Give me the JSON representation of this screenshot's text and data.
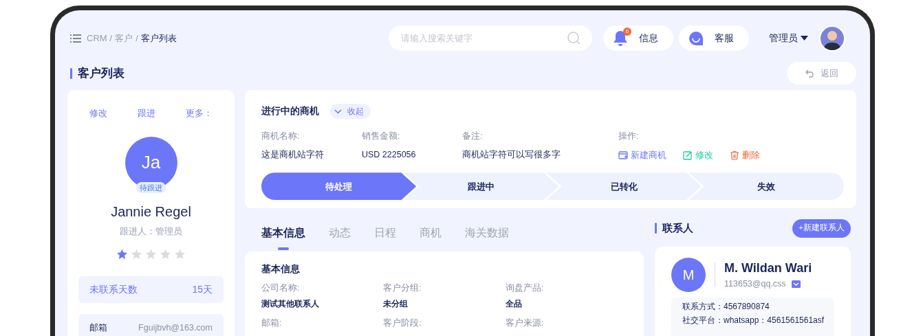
{
  "header": {
    "breadcrumb": [
      {
        "label": "CRM",
        "current": false
      },
      {
        "label": "客户",
        "current": false
      },
      {
        "label": "客户列表",
        "current": true
      }
    ],
    "separator": "/",
    "search": {
      "placeholder": "请输入搜索关键字"
    },
    "messages": {
      "label": "信息",
      "badge": "6"
    },
    "support": {
      "label": "客服"
    },
    "user": {
      "name": "管理员"
    }
  },
  "page_title": "客户列表",
  "back_button": "返回",
  "customer": {
    "actions": [
      "修改",
      "跟进",
      "更多："
    ],
    "initials": "Ja",
    "status_badge": "待跟进",
    "name": "Jannie Regel",
    "follower": "跟进人：管理员",
    "stars": 1,
    "days_uncontacted": {
      "label": "未联系天数",
      "value": "15天"
    },
    "email": {
      "label": "邮箱",
      "value": "Fguijbvh@163.com"
    }
  },
  "opportunities": {
    "title": "进行中的商机",
    "collapse_button": "收起",
    "fields": [
      {
        "label": "商机名称:",
        "value": "这是商机站字符"
      },
      {
        "label": "销售金额:",
        "value": "USD 2225056"
      },
      {
        "label": "备注:",
        "value": "商机站字符可以写很多字"
      }
    ],
    "actions_label": "操作:",
    "actions": [
      {
        "label": "新建商机",
        "kind": "create"
      },
      {
        "label": "修改",
        "kind": "edit"
      },
      {
        "label": "删除",
        "kind": "delete"
      }
    ],
    "stages": [
      {
        "label": "待处理",
        "selected": true
      },
      {
        "label": "跟进中",
        "selected": false
      },
      {
        "label": "已转化",
        "selected": false
      },
      {
        "label": "失效",
        "selected": false
      }
    ]
  },
  "tabs": [
    {
      "label": "基本信息",
      "selected": true
    },
    {
      "label": "动态",
      "selected": false
    },
    {
      "label": "日程",
      "selected": false
    },
    {
      "label": "商机",
      "selected": false
    },
    {
      "label": "海关数据",
      "selected": false
    }
  ],
  "basic_info": {
    "title": "基本信息",
    "fields": [
      {
        "label": "公司名称:",
        "value": "测试其他联系人"
      },
      {
        "label": "客户分组:",
        "value": "未分组"
      },
      {
        "label": "询盘产品:",
        "value": "全品"
      },
      {
        "label": "邮箱:"
      },
      {
        "label": "客户阶段:"
      },
      {
        "label": "客户来源:"
      }
    ]
  },
  "contacts": {
    "title": "联系人",
    "add_button": "+新建联系人",
    "card": {
      "initials": "M",
      "name": "M. Wildan Wari",
      "email": "113653@qq.css",
      "details": [
        "联系方式：4567890874",
        "社交平台：whatsapp：4561561561asf"
      ]
    }
  }
}
